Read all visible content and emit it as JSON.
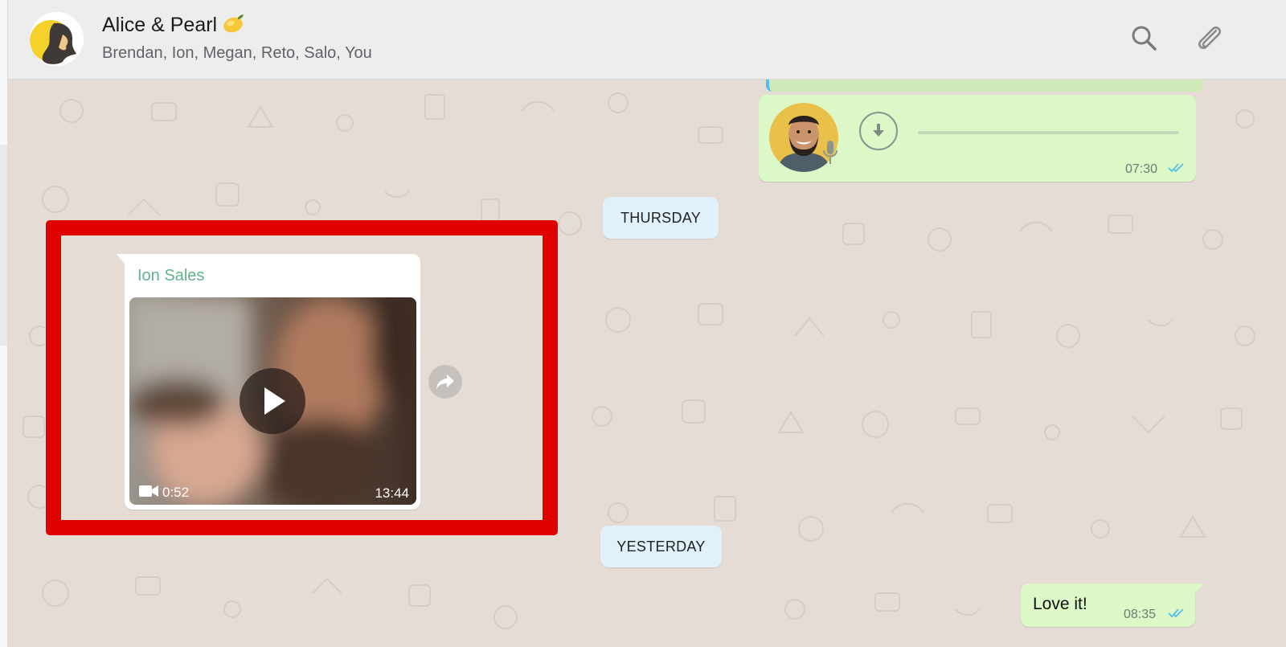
{
  "header": {
    "title": "Alice & Pearl",
    "title_emoji": "lemon",
    "participants": "Brendan, Ion, Megan, Reto, Salo, You",
    "icons": [
      "search-icon",
      "paperclip-icon"
    ]
  },
  "messages": {
    "voice_note": {
      "time": "07:30",
      "status": "read"
    },
    "day_thursday": "THURSDAY",
    "video_message": {
      "sender": "Ion Sales",
      "duration": "0:52",
      "time": "13:44"
    },
    "day_yesterday": "YESTERDAY",
    "text_message": {
      "text": "Love it!",
      "time": "08:35",
      "status": "read"
    }
  },
  "colors": {
    "outgoing_bubble": "#dcf8c6",
    "incoming_bubble": "#ffffff",
    "chat_background": "#e5ddd5",
    "sender_name": "#63b38f",
    "read_ticks": "#53bdeb",
    "highlight_box": "#e00000",
    "day_pill": "#e1f1fb"
  }
}
